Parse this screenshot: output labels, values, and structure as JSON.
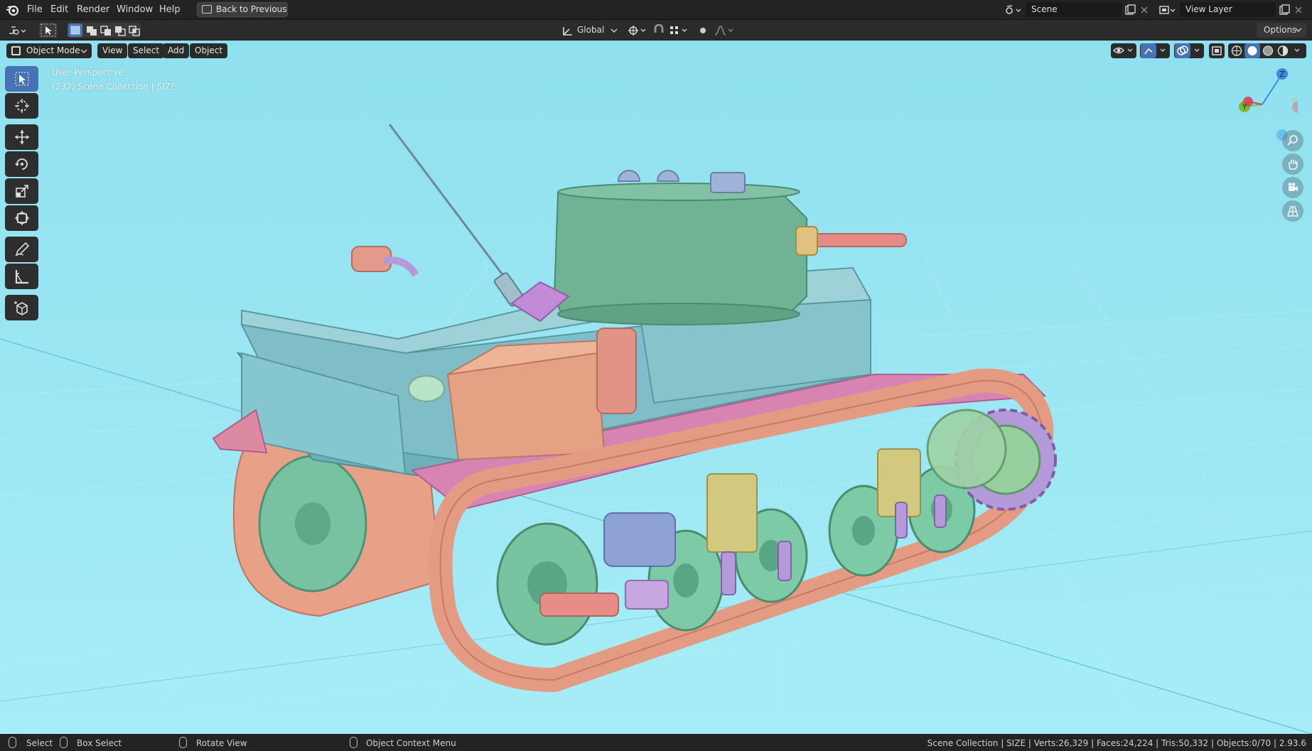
{
  "topbar": {
    "menu": [
      "File",
      "Edit",
      "Render",
      "Window",
      "Help"
    ],
    "back_button": "Back to Previous",
    "scene_name": "Scene",
    "view_layer": "View Layer"
  },
  "tool_header": {
    "transform_orientation": "Global",
    "options_label": "Options"
  },
  "viewport_header": {
    "mode": "Object Mode",
    "menus": [
      "View",
      "Select",
      "Add",
      "Object"
    ]
  },
  "viewport": {
    "perspective_label": "User Perspective",
    "collection_label": "(232) Scene Collection | SIZE",
    "background_color": "#9be7f4",
    "gizmo_axes": [
      "Z",
      "Y"
    ]
  },
  "toolbar": {
    "tools": [
      "select-box",
      "cursor",
      "move",
      "rotate",
      "scale",
      "transform",
      "annotate",
      "measure",
      "add-cube"
    ],
    "active_tool": "select-box"
  },
  "statusbar": {
    "select": "Select",
    "box_select": "Box Select",
    "rotate_view": "Rotate View",
    "context_menu": "Object Context Menu",
    "stats": "Scene Collection | SIZE | Verts:26,329 | Faces:24,224 | Tris:50,332 | Objects:0/70 | 2.93.6"
  },
  "scene_colors": {
    "hull": "#7fc0c7",
    "tracks": "#e49b83",
    "turret": "#6fb394",
    "fenders": "#d980b0",
    "wheels": "#7cc6a4",
    "accents": "#b49ad8"
  }
}
